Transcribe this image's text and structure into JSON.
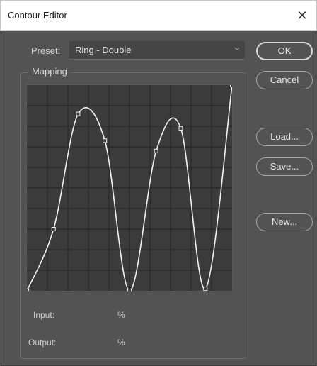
{
  "window": {
    "title": "Contour Editor",
    "close_glyph": "✕"
  },
  "preset": {
    "label": "Preset:",
    "value": "Ring - Double"
  },
  "mapping": {
    "legend": "Mapping",
    "curve_points": [
      {
        "input": 0,
        "output": 0
      },
      {
        "input": 13,
        "output": 30
      },
      {
        "input": 25,
        "output": 86
      },
      {
        "input": 38,
        "output": 73
      },
      {
        "input": 50,
        "output": 0
      },
      {
        "input": 63,
        "output": 68
      },
      {
        "input": 75,
        "output": 79
      },
      {
        "input": 87,
        "output": 1
      },
      {
        "input": 100,
        "output": 100
      }
    ],
    "input_label": "Input:",
    "input_unit": "%",
    "output_label": "Output:",
    "output_unit": "%"
  },
  "buttons": {
    "ok": "OK",
    "cancel": "Cancel",
    "load": "Load...",
    "save": "Save...",
    "new": "New..."
  },
  "colors": {
    "dialog_bg": "#535353",
    "graph_bg": "#3b3b3b",
    "curve": "#f2f2f2"
  }
}
